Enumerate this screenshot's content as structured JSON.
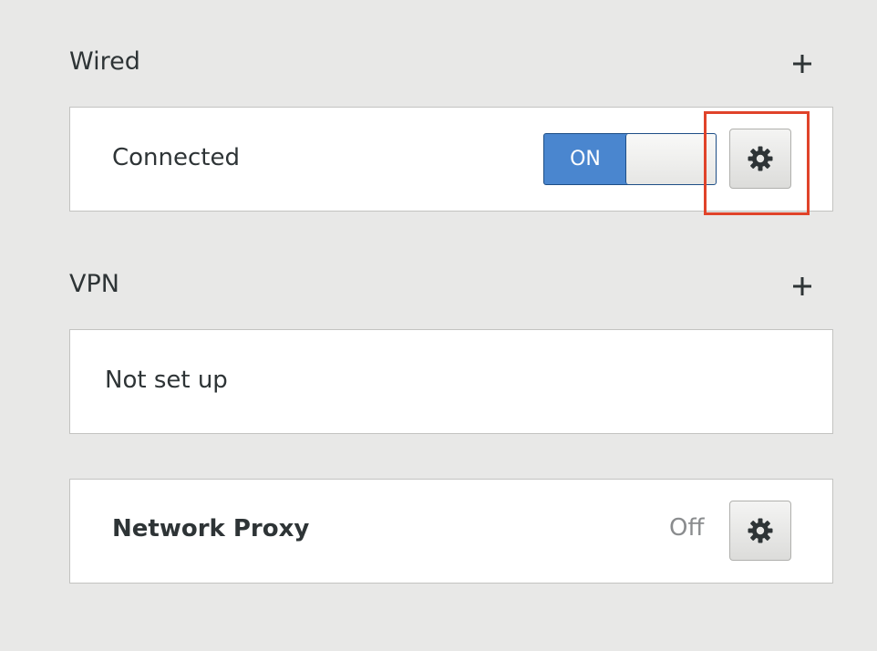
{
  "sections": {
    "wired": {
      "title": "Wired",
      "add_symbol": "+",
      "connection": {
        "status_label": "Connected",
        "switch_state": "ON"
      }
    },
    "vpn": {
      "title": "VPN",
      "add_symbol": "+",
      "empty_label": "Not set up"
    },
    "proxy": {
      "label": "Network Proxy",
      "status": "Off"
    }
  },
  "icons": {
    "add": "plus-icon",
    "settings": "gear-icon"
  },
  "colors": {
    "switch_on": "#4a86cf",
    "highlight": "#e0432a",
    "background": "#e8e8e7"
  }
}
